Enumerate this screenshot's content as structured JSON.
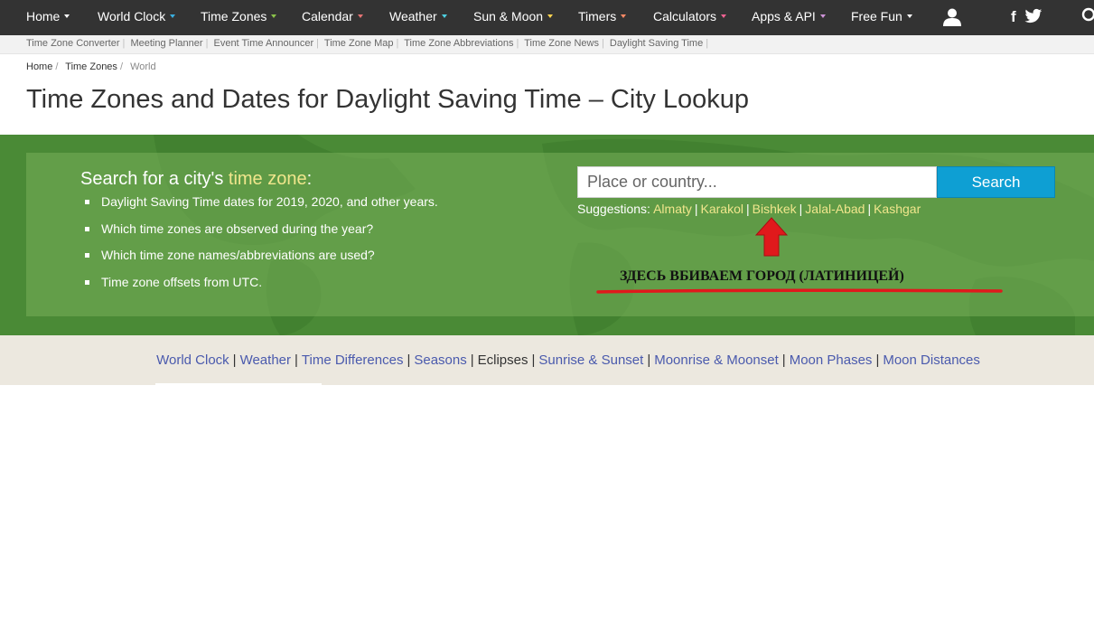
{
  "nav": {
    "items": [
      {
        "label": "Home"
      },
      {
        "label": "World Clock"
      },
      {
        "label": "Time Zones"
      },
      {
        "label": "Calendar"
      },
      {
        "label": "Weather"
      },
      {
        "label": "Sun & Moon"
      },
      {
        "label": "Timers"
      },
      {
        "label": "Calculators"
      },
      {
        "label": "Apps & API"
      },
      {
        "label": "Free Fun"
      }
    ],
    "icons": [
      "user-icon",
      "facebook-icon",
      "twitter-icon",
      "search-icon"
    ]
  },
  "subnav": {
    "links": [
      "Time Zone Converter",
      "Meeting Planner",
      "Event Time Announcer",
      "Time Zone Map",
      "Time Zone Abbreviations",
      "Time Zone News",
      "Daylight Saving Time"
    ]
  },
  "breadcrumb": {
    "items": [
      "Home",
      "Time Zones",
      "World"
    ]
  },
  "page": {
    "title": "Time Zones and Dates for Daylight Saving Time – City Lookup"
  },
  "search": {
    "heading_prefix": "Search for a city's ",
    "heading_highlight": "time zone",
    "heading_suffix": ":",
    "features": [
      "Daylight Saving Time dates for 2019, 2020, and other years.",
      "Which time zones are observed during the year?",
      "Which time zone names/abbreviations are used?",
      "Time zone offsets from UTC."
    ],
    "placeholder": "Place or country...",
    "button_label": "Search",
    "suggestions_label": "Suggestions:",
    "suggestions": [
      "Almaty",
      "Karakol",
      "Bishkek",
      "Jalal-Abad",
      "Kashgar"
    ]
  },
  "annotation": {
    "text": "ЗДЕСЬ ВБИВАЕМ ГОРОД (ЛАТИНИЦЕЙ)"
  },
  "bottom_links": {
    "items": [
      {
        "label": "World Clock",
        "link": true
      },
      {
        "label": "Weather",
        "link": true
      },
      {
        "label": "Time Differences",
        "link": true
      },
      {
        "label": "Seasons",
        "link": true
      },
      {
        "label": "Eclipses",
        "link": false
      },
      {
        "label": "Sunrise & Sunset",
        "link": true
      },
      {
        "label": "Moonrise & Moonset",
        "link": true
      },
      {
        "label": "Moon Phases",
        "link": true
      },
      {
        "label": "Moon Distances",
        "link": true
      }
    ]
  },
  "colors": {
    "nav_bg": "#333333",
    "green_bg": "#4a8a36",
    "highlight": "#f0e68c",
    "button": "#0e9fd3",
    "link": "#4a5aad",
    "annotation_red": "#e0191c"
  }
}
